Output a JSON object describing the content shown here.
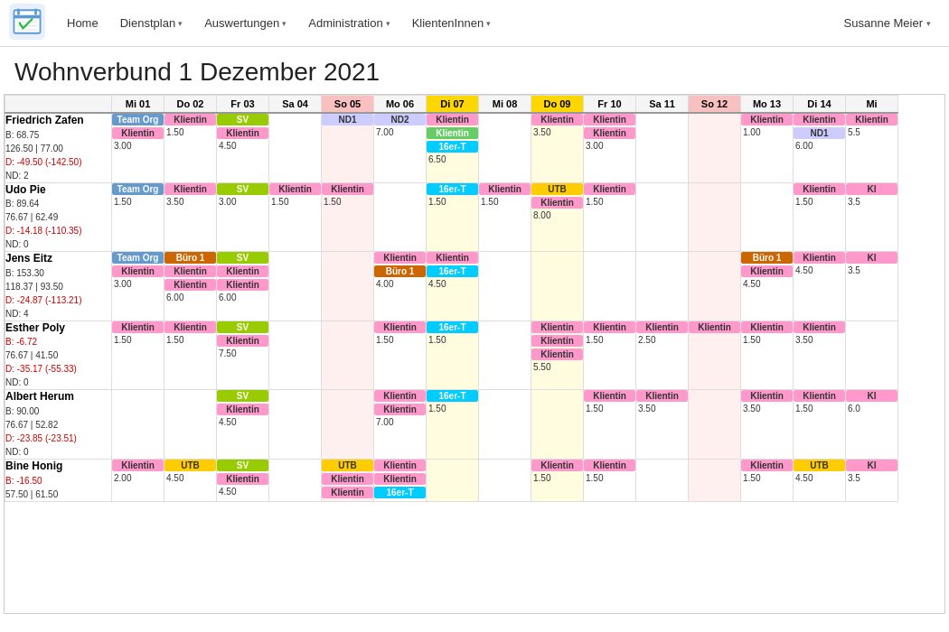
{
  "nav": {
    "items": [
      {
        "label": "Home",
        "hasDropdown": false
      },
      {
        "label": "Dienstplan",
        "hasDropdown": true
      },
      {
        "label": "Auswertungen",
        "hasDropdown": true
      },
      {
        "label": "Administration",
        "hasDropdown": true
      },
      {
        "label": "KlientenInnen",
        "hasDropdown": true
      }
    ],
    "user": "Susanne Meier"
  },
  "pageTitle": "Wohnverbund 1 Dezember 2021",
  "headers": [
    {
      "label": "Mi 01",
      "type": "normal"
    },
    {
      "label": "Do 02",
      "type": "normal"
    },
    {
      "label": "Fr 03",
      "type": "normal"
    },
    {
      "label": "Sa 04",
      "type": "normal"
    },
    {
      "label": "So 05",
      "type": "sunday"
    },
    {
      "label": "Mo 06",
      "type": "normal"
    },
    {
      "label": "Di 07",
      "type": "today"
    },
    {
      "label": "Mi 08",
      "type": "normal"
    },
    {
      "label": "Do 09",
      "type": "today"
    },
    {
      "label": "Fr 10",
      "type": "normal"
    },
    {
      "label": "Sa 11",
      "type": "normal"
    },
    {
      "label": "So 12",
      "type": "sunday"
    },
    {
      "label": "Mo 13",
      "type": "normal"
    },
    {
      "label": "Di 14",
      "type": "normal"
    },
    {
      "label": "Mi",
      "type": "normal"
    }
  ],
  "employees": [
    {
      "name": "Friedrich Zafen",
      "stats": "B: 68.75\n126.50 | 77.00\nD: -49.50 (-142.50)\nND: 2",
      "hasNegative": true,
      "days": [
        [
          {
            "label": "Team Org",
            "cls": "c-team"
          },
          {
            "label": "Klientin",
            "cls": "c-klientin",
            "hours": "3.00"
          }
        ],
        [
          {
            "label": "Klientin",
            "cls": "c-klientin",
            "hours": "1.50"
          }
        ],
        [
          {
            "label": "SV",
            "cls": "c-sv"
          },
          {
            "label": "Klientin",
            "cls": "c-klientin",
            "hours": "4.50"
          }
        ],
        [],
        [
          {
            "label": "ND1",
            "cls": "c-nd1"
          }
        ],
        [
          {
            "label": "ND2",
            "cls": "c-nd1",
            "hours": "7.00"
          }
        ],
        [
          {
            "label": "Klientin",
            "cls": "c-klientin"
          },
          {
            "label": "Klientin",
            "cls": "c-klientin-green"
          },
          {
            "label": "16er-T",
            "cls": "c-16er",
            "hours": "6.50"
          }
        ],
        [],
        [
          {
            "label": "Klientin",
            "cls": "c-klientin",
            "hours": "3.50"
          }
        ],
        [
          {
            "label": "Klientin",
            "cls": "c-klientin"
          },
          {
            "label": "Klientin",
            "cls": "c-klientin",
            "hours": "3.00"
          }
        ],
        [],
        [],
        [
          {
            "label": "Klientin",
            "cls": "c-klientin",
            "hours": "1.00"
          }
        ],
        [
          {
            "label": "Klientin",
            "cls": "c-klientin"
          },
          {
            "label": "ND1",
            "cls": "c-nd1",
            "hours": "6.00"
          }
        ],
        [
          {
            "label": "Klientin",
            "cls": "c-klientin",
            "hours": "5.5"
          }
        ]
      ]
    },
    {
      "name": "Udo Pie",
      "stats": "B: 89.64\n76.67 | 62.49\nD: -14.18 (-110.35)\nND: 0",
      "hasNegative": true,
      "days": [
        [
          {
            "label": "Team Org",
            "cls": "c-team"
          },
          {
            "label": "",
            "cls": "",
            "hours": "1.50"
          }
        ],
        [
          {
            "label": "Klientin",
            "cls": "c-klientin",
            "hours": "3.50"
          }
        ],
        [
          {
            "label": "SV",
            "cls": "c-sv"
          },
          {
            "label": "",
            "cls": "",
            "hours": "3.00"
          }
        ],
        [
          {
            "label": "Klientin",
            "cls": "c-klientin",
            "hours": "1.50"
          }
        ],
        [
          {
            "label": "Klientin",
            "cls": "c-klientin",
            "hours": "1.50"
          }
        ],
        [],
        [
          {
            "label": "16er-T",
            "cls": "c-16er",
            "hours": "1.50"
          }
        ],
        [
          {
            "label": "Klientin",
            "cls": "c-klientin",
            "hours": "1.50"
          }
        ],
        [
          {
            "label": "UTB",
            "cls": "c-utb"
          },
          {
            "label": "Klientin",
            "cls": "c-klientin",
            "hours": "8.00"
          }
        ],
        [
          {
            "label": "Klientin",
            "cls": "c-klientin",
            "hours": "1.50"
          }
        ],
        [],
        [],
        [],
        [
          {
            "label": "Klientin",
            "cls": "c-klientin",
            "hours": "1.50"
          }
        ],
        [
          {
            "label": "Kl",
            "cls": "c-klientin"
          },
          {
            "label": "",
            "cls": "",
            "hours": "3.5"
          }
        ]
      ]
    },
    {
      "name": "Jens Eitz",
      "stats": "B: 153.30\n118.37 | 93.50\nD: -24.87 (-113.21)\nND: 4",
      "hasNegative": true,
      "days": [
        [
          {
            "label": "Team Org",
            "cls": "c-team"
          },
          {
            "label": "Klientin",
            "cls": "c-klientin",
            "hours": "3.00"
          }
        ],
        [
          {
            "label": "Büro 1",
            "cls": "c-buero"
          },
          {
            "label": "Klientin",
            "cls": "c-klientin"
          },
          {
            "label": "Klientin",
            "cls": "c-klientin",
            "hours": "6.00"
          }
        ],
        [
          {
            "label": "SV",
            "cls": "c-sv"
          },
          {
            "label": "Klientin",
            "cls": "c-klientin"
          },
          {
            "label": "Klientin",
            "cls": "c-klientin",
            "hours": "6.00"
          }
        ],
        [],
        [],
        [
          {
            "label": "Klientin",
            "cls": "c-klientin"
          },
          {
            "label": "Büro 1",
            "cls": "c-buero",
            "hours": "4.00"
          }
        ],
        [
          {
            "label": "Klientin",
            "cls": "c-klientin"
          },
          {
            "label": "16er-T",
            "cls": "c-16er",
            "hours": "4.50"
          }
        ],
        [],
        [],
        [],
        [],
        [],
        [
          {
            "label": "Büro 1",
            "cls": "c-buero"
          },
          {
            "label": "Klientin",
            "cls": "c-klientin",
            "hours": "4.50"
          }
        ],
        [
          {
            "label": "Klientin",
            "cls": "c-klientin",
            "hours": "4.50"
          }
        ],
        [
          {
            "label": "Kl",
            "cls": "c-klientin",
            "hours": "3.5"
          }
        ]
      ]
    },
    {
      "name": "Esther Poly",
      "stats": "B: -6.72\n76.67 | 41.50\nD: -35.17 (-55.33)\nND: 0",
      "hasNegative": true,
      "days": [
        [
          {
            "label": "Klientin",
            "cls": "c-klientin",
            "hours": "1.50"
          }
        ],
        [
          {
            "label": "Klientin",
            "cls": "c-klientin",
            "hours": "1.50"
          }
        ],
        [
          {
            "label": "SV",
            "cls": "c-sv"
          },
          {
            "label": "Klientin",
            "cls": "c-klientin",
            "hours": "7.50"
          }
        ],
        [],
        [],
        [
          {
            "label": "Klientin",
            "cls": "c-klientin",
            "hours": "1.50"
          }
        ],
        [
          {
            "label": "16er-T",
            "cls": "c-16er",
            "hours": "1.50"
          }
        ],
        [],
        [
          {
            "label": "Klientin",
            "cls": "c-klientin"
          },
          {
            "label": "Klientin",
            "cls": "c-klientin"
          },
          {
            "label": "Klientin",
            "cls": "c-klientin",
            "hours": "5.50"
          }
        ],
        [
          {
            "label": "Klientin",
            "cls": "c-klientin",
            "hours": "1.50"
          }
        ],
        [
          {
            "label": "Klientin",
            "cls": "c-klientin",
            "hours": "2.50"
          }
        ],
        [
          {
            "label": "Klientin",
            "cls": "c-klientin"
          }
        ],
        [
          {
            "label": "Klientin",
            "cls": "c-klientin",
            "hours": "1.50"
          }
        ],
        [
          {
            "label": "Klientin",
            "cls": "c-klientin",
            "hours": "3.50"
          }
        ],
        []
      ]
    },
    {
      "name": "Albert Herum",
      "stats": "B: 90.00\n76.67 | 52.82\nD: -23.85 (-23.51)\nND: 0",
      "hasNegative": true,
      "days": [
        [],
        [],
        [
          {
            "label": "SV",
            "cls": "c-sv"
          },
          {
            "label": "Klientin",
            "cls": "c-klientin",
            "hours": "4.50"
          }
        ],
        [],
        [],
        [
          {
            "label": "Klientin",
            "cls": "c-klientin"
          },
          {
            "label": "Klientin",
            "cls": "c-klientin",
            "hours": "7.00"
          }
        ],
        [
          {
            "label": "16er-T",
            "cls": "c-16er",
            "hours": "1.50"
          }
        ],
        [],
        [],
        [
          {
            "label": "Klientin",
            "cls": "c-klientin",
            "hours": "1.50"
          }
        ],
        [
          {
            "label": "Klientin",
            "cls": "c-klientin",
            "hours": "3.50"
          }
        ],
        [],
        [
          {
            "label": "Klientin",
            "cls": "c-klientin",
            "hours": "3.50"
          }
        ],
        [
          {
            "label": "Klientin",
            "cls": "c-klientin",
            "hours": "1.50"
          }
        ],
        [
          {
            "label": "Kl",
            "cls": "c-klientin",
            "hours": "6.0"
          }
        ]
      ]
    },
    {
      "name": "Bine Honig",
      "stats": "B: -16.50\n57.50 | 61.50",
      "hasNegative": true,
      "days": [
        [
          {
            "label": "Klientin",
            "cls": "c-klientin",
            "hours": "2.00"
          }
        ],
        [
          {
            "label": "UTB",
            "cls": "c-utb",
            "hours": "4.50"
          }
        ],
        [
          {
            "label": "SV",
            "cls": "c-sv"
          },
          {
            "label": "Klientin",
            "cls": "c-klientin",
            "hours": "4.50"
          }
        ],
        [],
        [
          {
            "label": "UTB",
            "cls": "c-utb"
          },
          {
            "label": "Klientin",
            "cls": "c-klientin"
          },
          {
            "label": "Klientin",
            "cls": "c-klientin"
          }
        ],
        [
          {
            "label": "Klientin",
            "cls": "c-klientin"
          },
          {
            "label": "Klientin",
            "cls": "c-klientin"
          },
          {
            "label": "16er-T",
            "cls": "c-16er"
          }
        ],
        [],
        [],
        [
          {
            "label": "Klientin",
            "cls": "c-klientin",
            "hours": "1.50"
          }
        ],
        [
          {
            "label": "Klientin",
            "cls": "c-klientin",
            "hours": "1.50"
          }
        ],
        [],
        [],
        [
          {
            "label": "Klientin",
            "cls": "c-klientin",
            "hours": "1.50"
          }
        ],
        [
          {
            "label": "UTB",
            "cls": "c-utb",
            "hours": "4.50"
          }
        ],
        [
          {
            "label": "Kl",
            "cls": "c-klientin",
            "hours": "3.5"
          }
        ]
      ]
    }
  ]
}
